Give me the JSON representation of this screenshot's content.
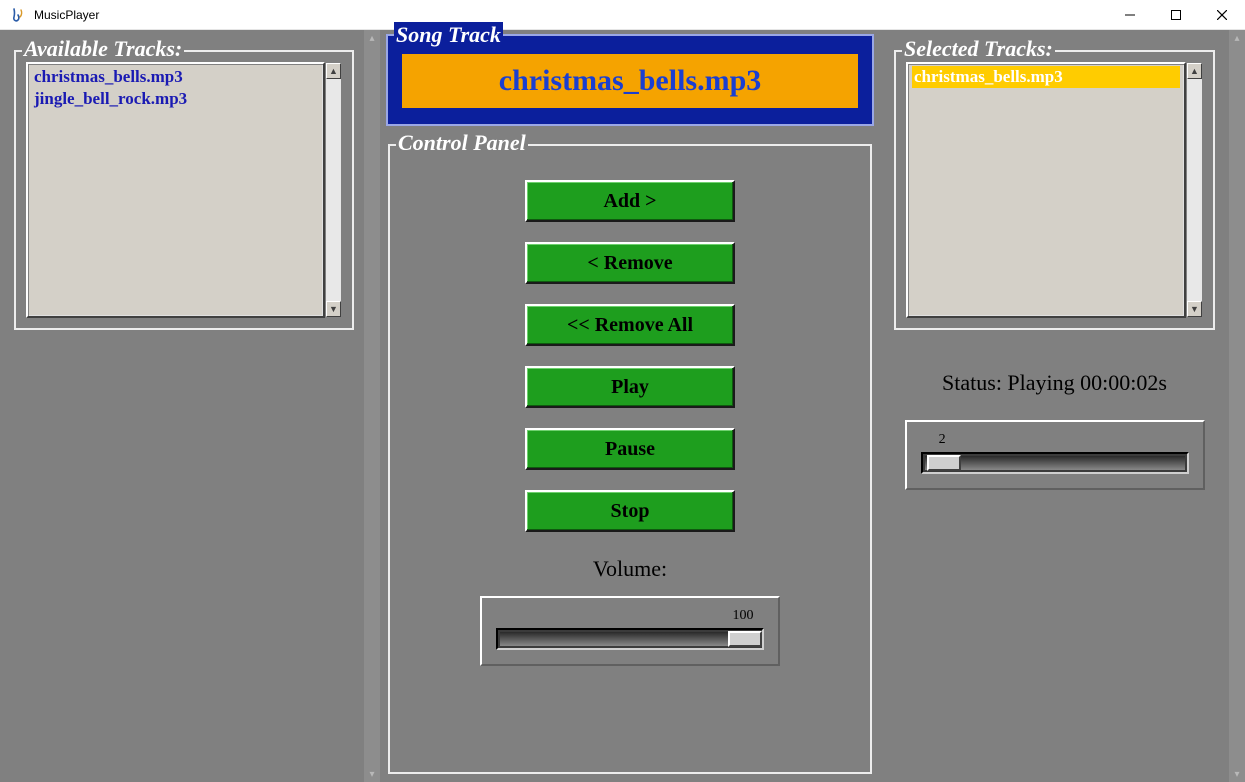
{
  "window": {
    "title": "MusicPlayer"
  },
  "available": {
    "legend": "Available Tracks:",
    "items": [
      "christmas_bells.mp3",
      "jingle_bell_rock.mp3"
    ]
  },
  "songtrack": {
    "legend": "Song Track",
    "now_playing": "christmas_bells.mp3"
  },
  "control": {
    "legend": "Control Panel",
    "buttons": {
      "add": "Add >",
      "remove": "< Remove",
      "remove_all": "<< Remove All",
      "play": "Play",
      "pause": "Pause",
      "stop": "Stop"
    },
    "volume_label": "Volume:",
    "volume_value": "100",
    "volume_min": 0,
    "volume_max": 100
  },
  "selected": {
    "legend": "Selected Tracks:",
    "items": [
      "christmas_bells.mp3"
    ],
    "selected_index": 0
  },
  "status": {
    "text": "Status: Playing 00:00:02s",
    "progress_value": "2",
    "progress_max": 100
  }
}
